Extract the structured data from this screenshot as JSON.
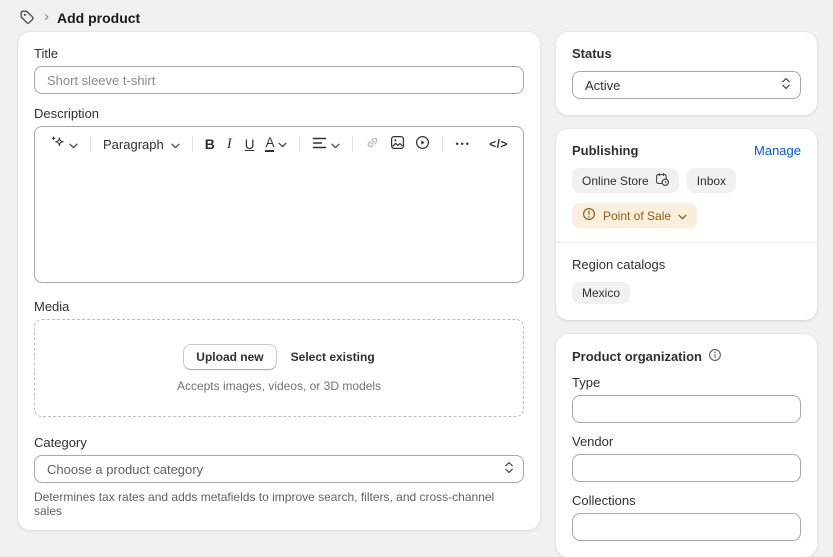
{
  "header": {
    "separator": "›",
    "title": "Add product"
  },
  "main": {
    "title_field": {
      "label": "Title",
      "placeholder": "Short sleeve t-shirt"
    },
    "description": {
      "label": "Description",
      "toolbar": {
        "paragraph": "Paragraph",
        "bold": "B",
        "italic": "I",
        "underline": "U",
        "text_color": "A",
        "more": "•••",
        "code": "</>"
      }
    },
    "media": {
      "label": "Media",
      "upload_button": "Upload new",
      "select_existing": "Select existing",
      "hint": "Accepts images, videos, or 3D models"
    },
    "category": {
      "label": "Category",
      "placeholder": "Choose a product category",
      "helper": "Determines tax rates and adds metafields to improve search, filters, and cross-channel sales"
    }
  },
  "sidebar": {
    "status": {
      "title": "Status",
      "value": "Active"
    },
    "publishing": {
      "title": "Publishing",
      "manage": "Manage",
      "channels": [
        "Online Store",
        "Inbox"
      ],
      "warning_channel": "Point of Sale",
      "region_catalogs_label": "Region catalogs",
      "region_catalogs": [
        "Mexico"
      ]
    },
    "organization": {
      "title": "Product organization",
      "fields": [
        {
          "label": "Type"
        },
        {
          "label": "Vendor"
        },
        {
          "label": "Collections"
        }
      ]
    }
  },
  "icons": {
    "products-tag-icon": "price-tag outline",
    "magic-icon": "sparkle / AI generate",
    "chevron-down-icon": "⌄",
    "align-icon": "text-align lines",
    "link-icon": "chain link (disabled)",
    "image-icon": "picture frame",
    "video-icon": "play in circle",
    "select-stepper-icon": "up+down chevrons",
    "calendar-clock-icon": "calendar with clock",
    "warning-icon": "(!) circle",
    "info-icon": "(i) circle"
  },
  "colors": {
    "page_bg": "#f1f1f1",
    "card_bg": "#ffffff",
    "link_blue": "#005bd3",
    "badge_bg": "#f1f1f1",
    "warning_badge_bg": "#fbeedc",
    "warning_badge_text": "#8a6116"
  }
}
